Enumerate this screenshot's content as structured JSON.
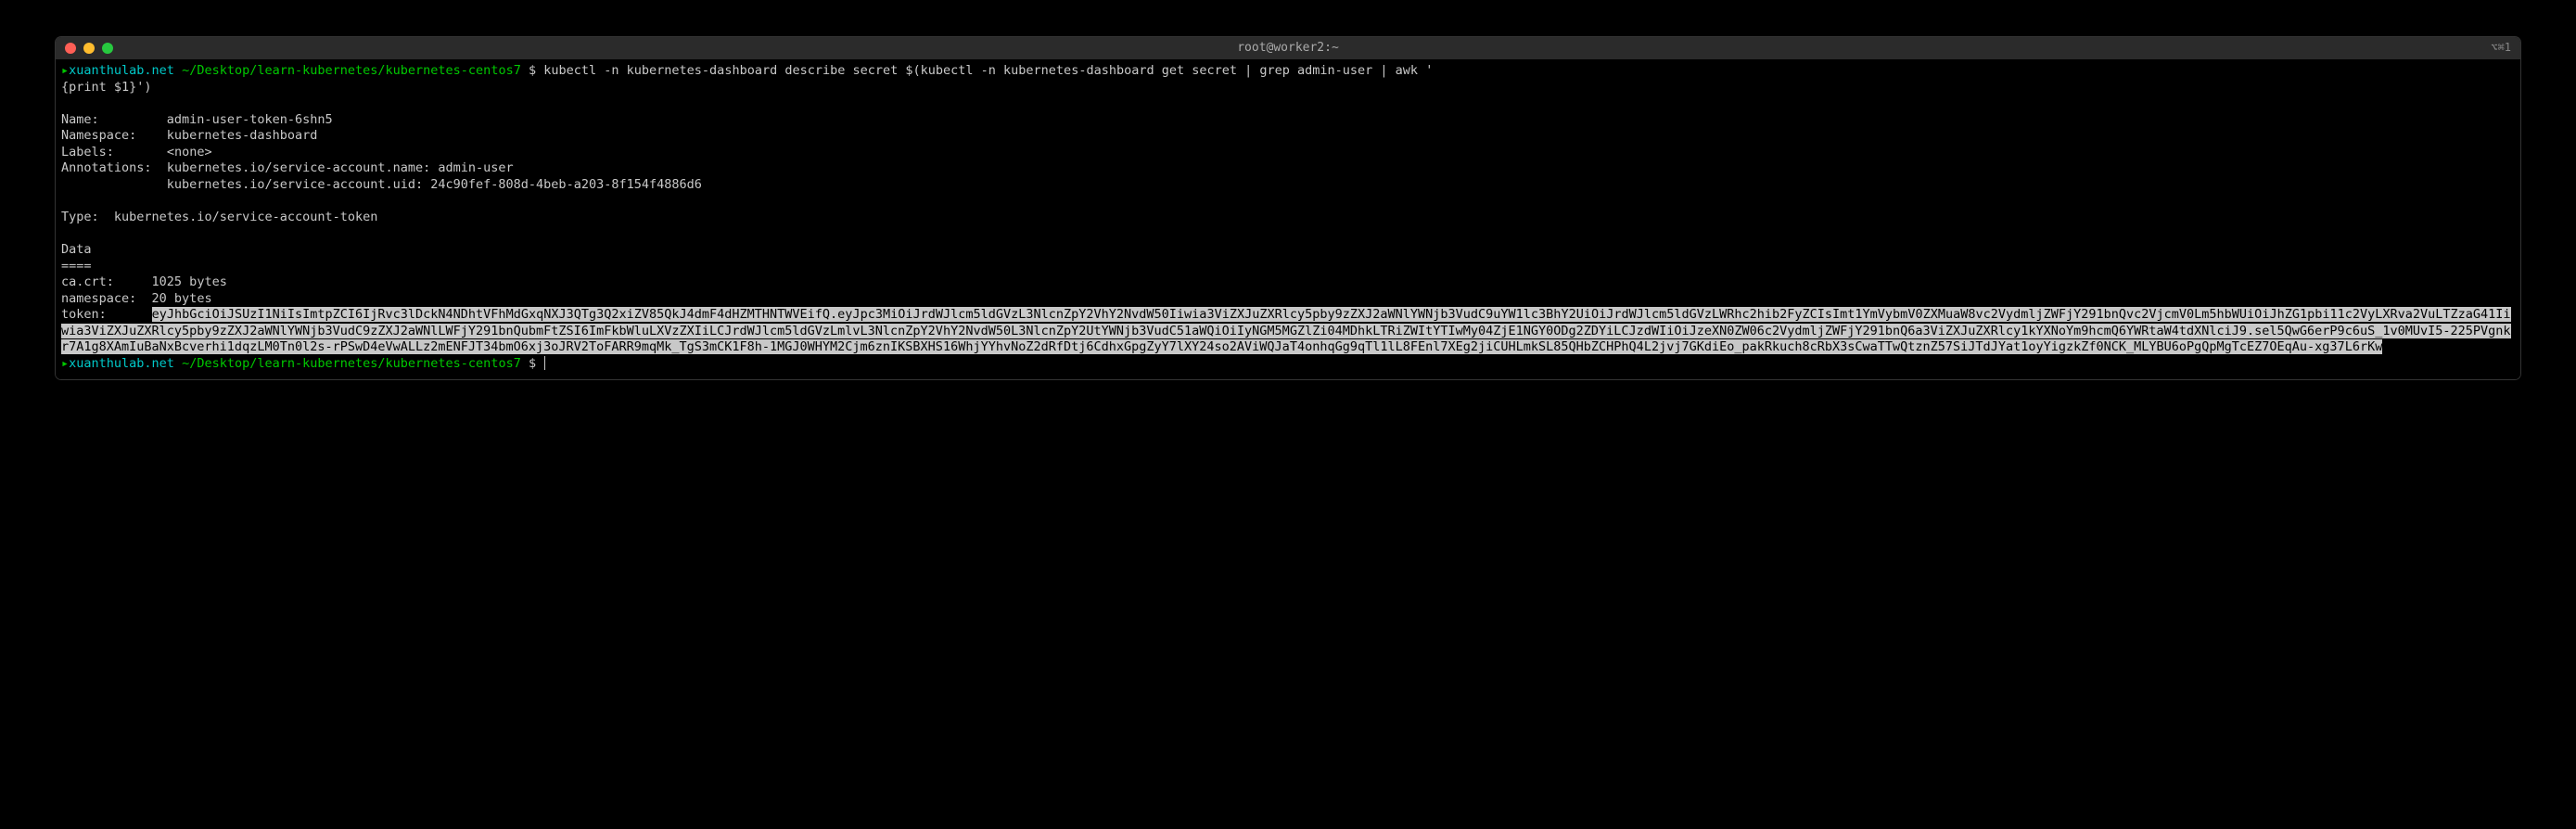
{
  "window": {
    "title": "root@worker2:~",
    "tab_indicator": "⌥⌘1"
  },
  "prompt1": {
    "arrow": "▸",
    "host": "xuanthulab.net",
    "path": "~/Desktop/learn-kubernetes/kubernetes-centos7",
    "dollar": "$",
    "command_line1": "kubectl -n kubernetes-dashboard describe secret $(kubectl -n kubernetes-dashboard get secret | grep admin-user | awk '",
    "command_line2": "{print $1}')"
  },
  "output": {
    "name_label": "Name:",
    "name_value": "admin-user-token-6shn5",
    "namespace_label": "Namespace:",
    "namespace_value": "kubernetes-dashboard",
    "labels_label": "Labels:",
    "labels_value": "<none>",
    "annotations_label": "Annotations:",
    "annotations_value1": "kubernetes.io/service-account.name: admin-user",
    "annotations_value2": "kubernetes.io/service-account.uid: 24c90fef-808d-4beb-a203-8f154f4886d6",
    "type_label": "Type:",
    "type_value": "kubernetes.io/service-account-token",
    "data_header": "Data",
    "data_sep": "====",
    "cacrt_label": "ca.crt:",
    "cacrt_value": "1025 bytes",
    "ns_label": "namespace:",
    "ns_value": "20 bytes",
    "token_label": "token:",
    "token_value": "eyJhbGciOiJSUzI1NiIsImtpZCI6IjRvc3lDckN4NDhtVFhMdGxqNXJ3QTg3Q2xiZV85QkJ4dmF4dHZMTHNTWVEifQ.eyJpc3MiOiJrdWJlcm5ldGVzL3NlcnZpY2VhY2NvdW50Iiwia3ViZXJuZXRlcy5pby9zZXJ2aWNlYWNjb3VudC9uYW1lc3BhY2UiOiJrdWJlcm5ldGVzLWRhc2hib2FyZCIsImt1YmVybmV0ZXMuaW8vc2VydmljZWFjY291bnQvc2VjcmV0Lm5hbWUiOiJhZG1pbi11c2VyLXRva2VuLTZzaG41Iiwia3ViZXJuZXRlcy5pby9zZXJ2aWNlYWNjb3VudC9zZXJ2aWNlLWFjY291bnQubmFtZSI6ImFkbWluLXVzZXIiLCJrdWJlcm5ldGVzLmlvL3NlcnZpY2VhY2NvdW50L3NlcnZpY2UtYWNjb3VudC51aWQiOiIyNGM5MGZlZi04MDhkLTRiZWItYTIwMy04ZjE1NGY0ODg2ZDYiLCJzdWIiOiJzeXN0ZW06c2VydmljZWFjY291bnQ6a3ViZXJuZXRlcy1kYXNoYm9hcmQ6YWRtaW4tdXNlciJ9.sel5QwG6erP9c6uS_1v0MUvI5-225PVgnkr7A1g8XAmIuBaNxBcverhi1dqzLM0Tn0l2s-rPSwD4eVwALLz2mENFJT34bmO6xj3oJRV2ToFARR9mqMk_TgS3mCK1F8h-1MGJ0WHYM2Cjm6znIKSBXHS16WhjYYhvNoZ2dRfDtj6CdhxGpgZyY7lXY24so2AViWQJaT4onhqGg9qTl1lL8FEnl7XEg2jiCUHLmkSL85QHbZCHPhQ4L2jvj7GKdiEo_pakRkuch8cRbX3sCwaTTwQtznZ57SiJTdJYat1oyYigzkZf0NCK_MLYBU6oPgQpMgTcEZ7OEqAu-xg37L6rKw"
  },
  "prompt2": {
    "arrow": "▸",
    "host": "xuanthulab.net",
    "path": "~/Desktop/learn-kubernetes/kubernetes-centos7",
    "dollar": "$"
  }
}
